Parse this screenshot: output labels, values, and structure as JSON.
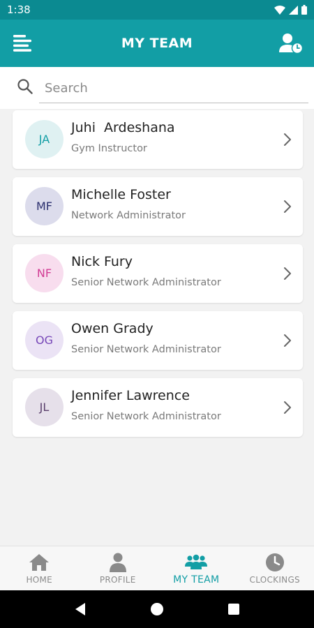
{
  "status_bar": {
    "time": "1:38"
  },
  "app_bar": {
    "title": "MY TEAM",
    "menu_icon": "menu-icon",
    "action_icon": "user-clock-icon"
  },
  "search": {
    "placeholder": "Search",
    "value": ""
  },
  "members": [
    {
      "initials": "JA",
      "name": "Juhi  Ardeshana",
      "role": "Gym Instructor",
      "avatar_bg": "#dff1f2",
      "avatar_fg": "#129ea5"
    },
    {
      "initials": "MF",
      "name": "Michelle Foster",
      "role": "Network Administrator",
      "avatar_bg": "#dcdcec",
      "avatar_fg": "#2b2f6e"
    },
    {
      "initials": "NF",
      "name": "Nick Fury",
      "role": "Senior Network Administrator",
      "avatar_bg": "#f8ddee",
      "avatar_fg": "#d23c94"
    },
    {
      "initials": "OG",
      "name": "Owen Grady",
      "role": "Senior Network Administrator",
      "avatar_bg": "#ebe3f5",
      "avatar_fg": "#7747b8"
    },
    {
      "initials": "JL",
      "name": "Jennifer Lawrence",
      "role": "Senior Network Administrator",
      "avatar_bg": "#e6e0ea",
      "avatar_fg": "#5a3f6b"
    }
  ],
  "bottom_nav": [
    {
      "label": "HOME",
      "icon": "home-icon",
      "active": false
    },
    {
      "label": "PROFILE",
      "icon": "person-icon",
      "active": false
    },
    {
      "label": "MY TEAM",
      "icon": "team-icon",
      "active": true
    },
    {
      "label": "CLOCKINGS",
      "icon": "clock-icon",
      "active": false
    }
  ],
  "colors": {
    "primary": "#129ea5",
    "primary_dark": "#0b8a91",
    "inactive": "#8a8a8a"
  }
}
